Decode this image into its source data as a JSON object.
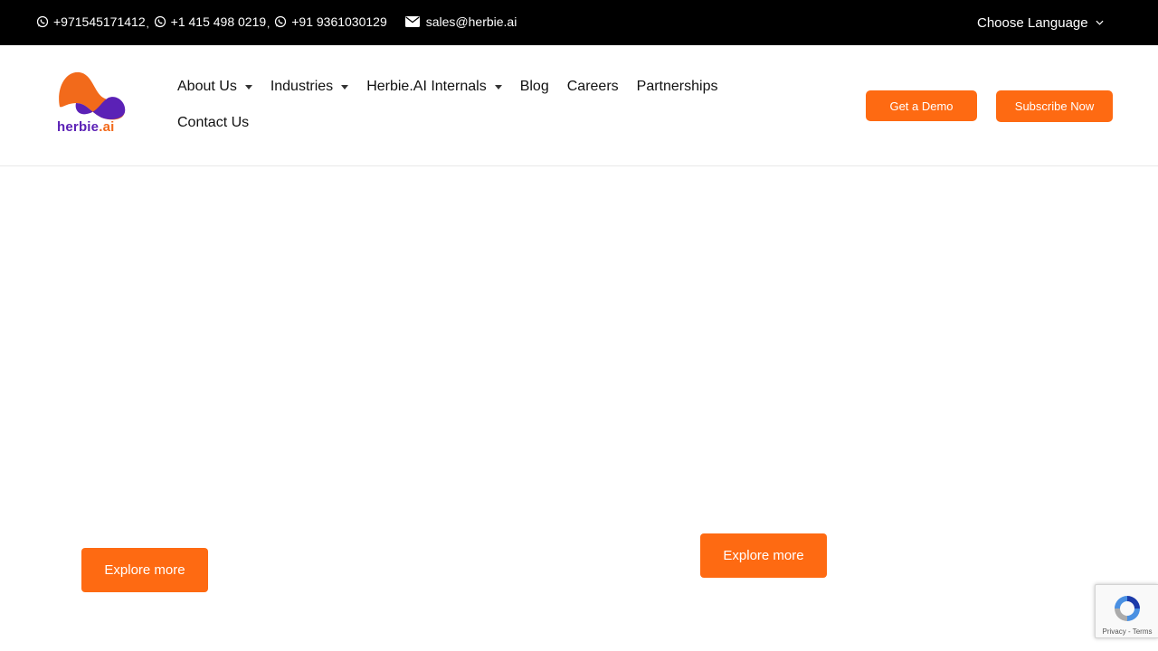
{
  "topbar": {
    "phones": [
      "+971545171412",
      "+1 415 498 0219",
      "+91 9361030129"
    ],
    "separator": ",",
    "email": "sales@herbie.ai",
    "language_label": "Choose Language"
  },
  "logo": {
    "text_main": "herbie",
    "text_dot": ".ai"
  },
  "nav": {
    "about": "About Us",
    "industries": "Industries",
    "internals": "Herbie.AI Internals",
    "blog": "Blog",
    "careers": "Careers",
    "partnerships": "Partnerships",
    "contact": "Contact Us"
  },
  "actions": {
    "demo": "Get a Demo",
    "subscribe": "Subscribe Now"
  },
  "content": {
    "explore_1": "Explore more",
    "explore_2": "Explore more"
  },
  "recaptcha": {
    "terms": "Privacy - Terms"
  },
  "colors": {
    "accent": "#fe6a12",
    "topbar": "#000000",
    "logo_purple": "#5b21b6",
    "logo_orange": "#f26a1b"
  }
}
